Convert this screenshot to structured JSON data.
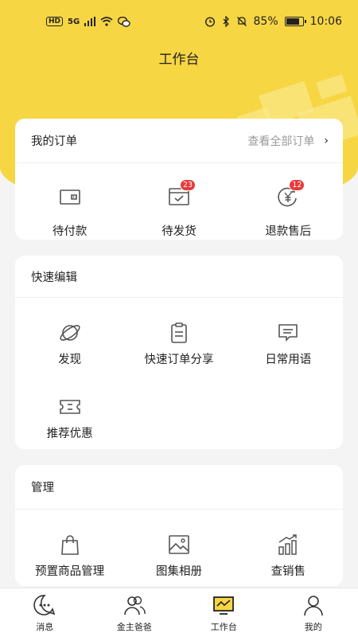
{
  "status_bar": {
    "hd": "HD",
    "network": "5G",
    "battery": "85%",
    "battery_level": 0.85,
    "time": "10:06"
  },
  "header": {
    "title": "工作台"
  },
  "orders": {
    "title": "我的订单",
    "view_all": "查看全部订单",
    "items": [
      {
        "icon": "wallet-icon",
        "label": "待付款",
        "badge": ""
      },
      {
        "icon": "calendar-check-icon",
        "label": "待发货",
        "badge": "23"
      },
      {
        "icon": "refund-yen-icon",
        "label": "退款售后",
        "badge": "12"
      }
    ]
  },
  "quick_edit": {
    "title": "快速编辑",
    "items": [
      {
        "icon": "planet-icon",
        "label": "发现"
      },
      {
        "icon": "clipboard-icon",
        "label": "快速订单分享"
      },
      {
        "icon": "message-icon",
        "label": "日常用语"
      },
      {
        "icon": "ticket-icon",
        "label": "推荐优惠"
      }
    ]
  },
  "management": {
    "title": "管理",
    "items": [
      {
        "icon": "shopping-bag-icon",
        "label": "预置商品管理"
      },
      {
        "icon": "image-icon",
        "label": "图集相册"
      },
      {
        "icon": "sales-chart-icon",
        "label": "查销售"
      }
    ]
  },
  "tabbar": {
    "items": [
      {
        "icon": "chat-bubble-icon",
        "label": "消息"
      },
      {
        "icon": "users-icon",
        "label": "金主爸爸"
      },
      {
        "icon": "monitor-icon",
        "label": "工作台",
        "active": true
      },
      {
        "icon": "person-icon",
        "label": "我的"
      }
    ]
  },
  "colors": {
    "brand_yellow": "#f7d644",
    "badge_red": "#e53b3b"
  }
}
